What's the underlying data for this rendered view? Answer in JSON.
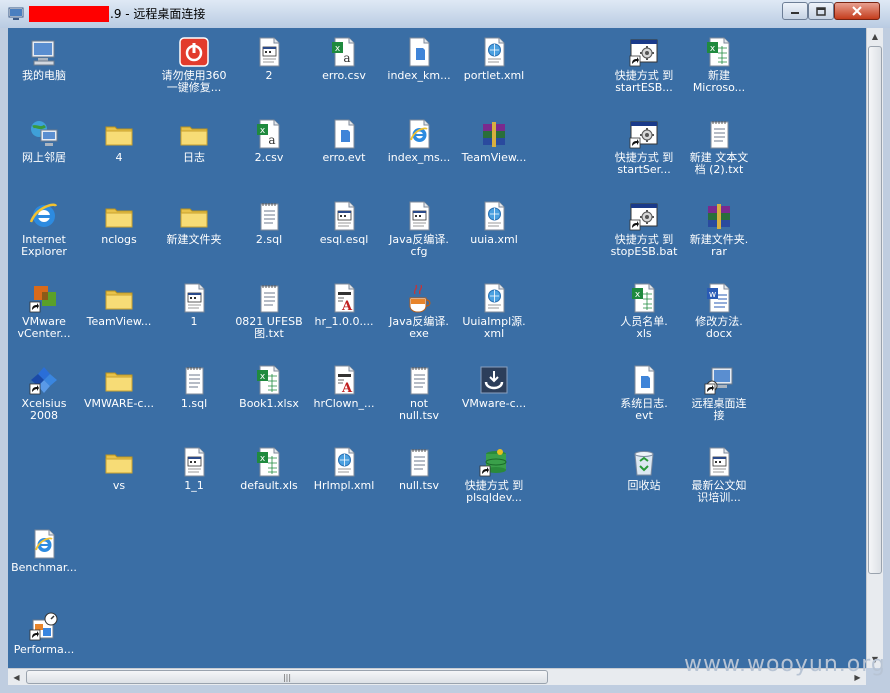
{
  "window": {
    "title": ".9 - 远程桌面连接",
    "min_symbol": "—",
    "max_symbol": "□",
    "close_symbol": "✕"
  },
  "desktop": {
    "background": "#3a6ea5",
    "icons": [
      {
        "label": "我的电脑",
        "icon": "my-computer"
      },
      {
        "label": "请勿使用360\n一键修复...",
        "icon": "red-app"
      },
      {
        "label": "2",
        "icon": "text-doc"
      },
      {
        "label": "erro.csv",
        "icon": "excel-csv"
      },
      {
        "label": "index_km...",
        "icon": "generic-file"
      },
      {
        "label": "portlet.xml",
        "icon": "xml-file"
      },
      {
        "label": "快捷方式 到\nstartESB...",
        "icon": "batch-shortcut"
      },
      {
        "label": "新建\nMicroso...",
        "icon": "excel-file"
      },
      {
        "label": "网上邻居",
        "icon": "network"
      },
      {
        "label": "4",
        "icon": "folder"
      },
      {
        "label": "日志",
        "icon": "folder"
      },
      {
        "label": "2.csv",
        "icon": "excel-csv"
      },
      {
        "label": "erro.evt",
        "icon": "generic-file"
      },
      {
        "label": "index_ms...",
        "icon": "ie-file"
      },
      {
        "label": "TeamView...",
        "icon": "winrar"
      },
      {
        "label": "快捷方式 到\nstartSer...",
        "icon": "batch-shortcut"
      },
      {
        "label": "新建 文本文\n档 (2).txt",
        "icon": "notepad"
      },
      {
        "label": "Internet\nExplorer",
        "icon": "ie"
      },
      {
        "label": "nclogs",
        "icon": "folder"
      },
      {
        "label": "新建文件夹",
        "icon": "folder"
      },
      {
        "label": "2.sql",
        "icon": "notepad"
      },
      {
        "label": "esql.esql",
        "icon": "text-doc"
      },
      {
        "label": "Java反编译.\ncfg",
        "icon": "text-doc"
      },
      {
        "label": "uuia.xml",
        "icon": "xml-file"
      },
      {
        "label": "快捷方式 到\nstopESB.bat",
        "icon": "batch-shortcut"
      },
      {
        "label": "新建文件夹.\nrar",
        "icon": "winrar"
      },
      {
        "label": "VMware\nvCenter...",
        "icon": "vmware-shortcut"
      },
      {
        "label": "TeamView...",
        "icon": "folder"
      },
      {
        "label": "1",
        "icon": "text-doc"
      },
      {
        "label": "0821 UFESB\n图.txt",
        "icon": "notepad"
      },
      {
        "label": "hr_1.0.0....",
        "icon": "doc-a"
      },
      {
        "label": "Java反编译.\nexe",
        "icon": "java"
      },
      {
        "label": "UuiaImpl源.\nxml",
        "icon": "xml-file"
      },
      {
        "label": "人员名单.\nxls",
        "icon": "excel-file"
      },
      {
        "label": "修改方法.\ndocx",
        "icon": "word-file"
      },
      {
        "label": "Xcelsius\n2008",
        "icon": "xcelsius"
      },
      {
        "label": "VMWARE-c...",
        "icon": "folder"
      },
      {
        "label": "1.sql",
        "icon": "notepad"
      },
      {
        "label": "Book1.xlsx",
        "icon": "excel-file"
      },
      {
        "label": "hrClown_...",
        "icon": "doc-a"
      },
      {
        "label": "not\nnull.tsv",
        "icon": "notepad"
      },
      {
        "label": "VMware-c...",
        "icon": "vmware-dark"
      },
      {
        "label": "系统日志.\nevt",
        "icon": "generic-file"
      },
      {
        "label": "远程桌面连\n接",
        "icon": "remote-desktop"
      },
      {
        "label": "vs",
        "icon": "folder"
      },
      {
        "label": "1_1",
        "icon": "text-doc"
      },
      {
        "label": "default.xls",
        "icon": "excel-file"
      },
      {
        "label": "HrImpl.xml",
        "icon": "xml-file"
      },
      {
        "label": "null.tsv",
        "icon": "notepad"
      },
      {
        "label": "快捷方式 到\nplsqldev...",
        "icon": "plsql-shortcut"
      },
      {
        "label": "回收站",
        "icon": "recycle-bin"
      },
      {
        "label": "最新公文知\n识培训...",
        "icon": "text-doc"
      },
      {
        "label": "Benchmar...",
        "icon": "ie-file"
      },
      {
        "label": "Performa...",
        "icon": "performance"
      }
    ]
  },
  "scrollbars": {
    "up_arrow": "▲",
    "down_arrow": "▼",
    "left_arrow": "◀",
    "right_arrow": "▶",
    "grip": "|||"
  },
  "watermark": "www.wooyun.org"
}
